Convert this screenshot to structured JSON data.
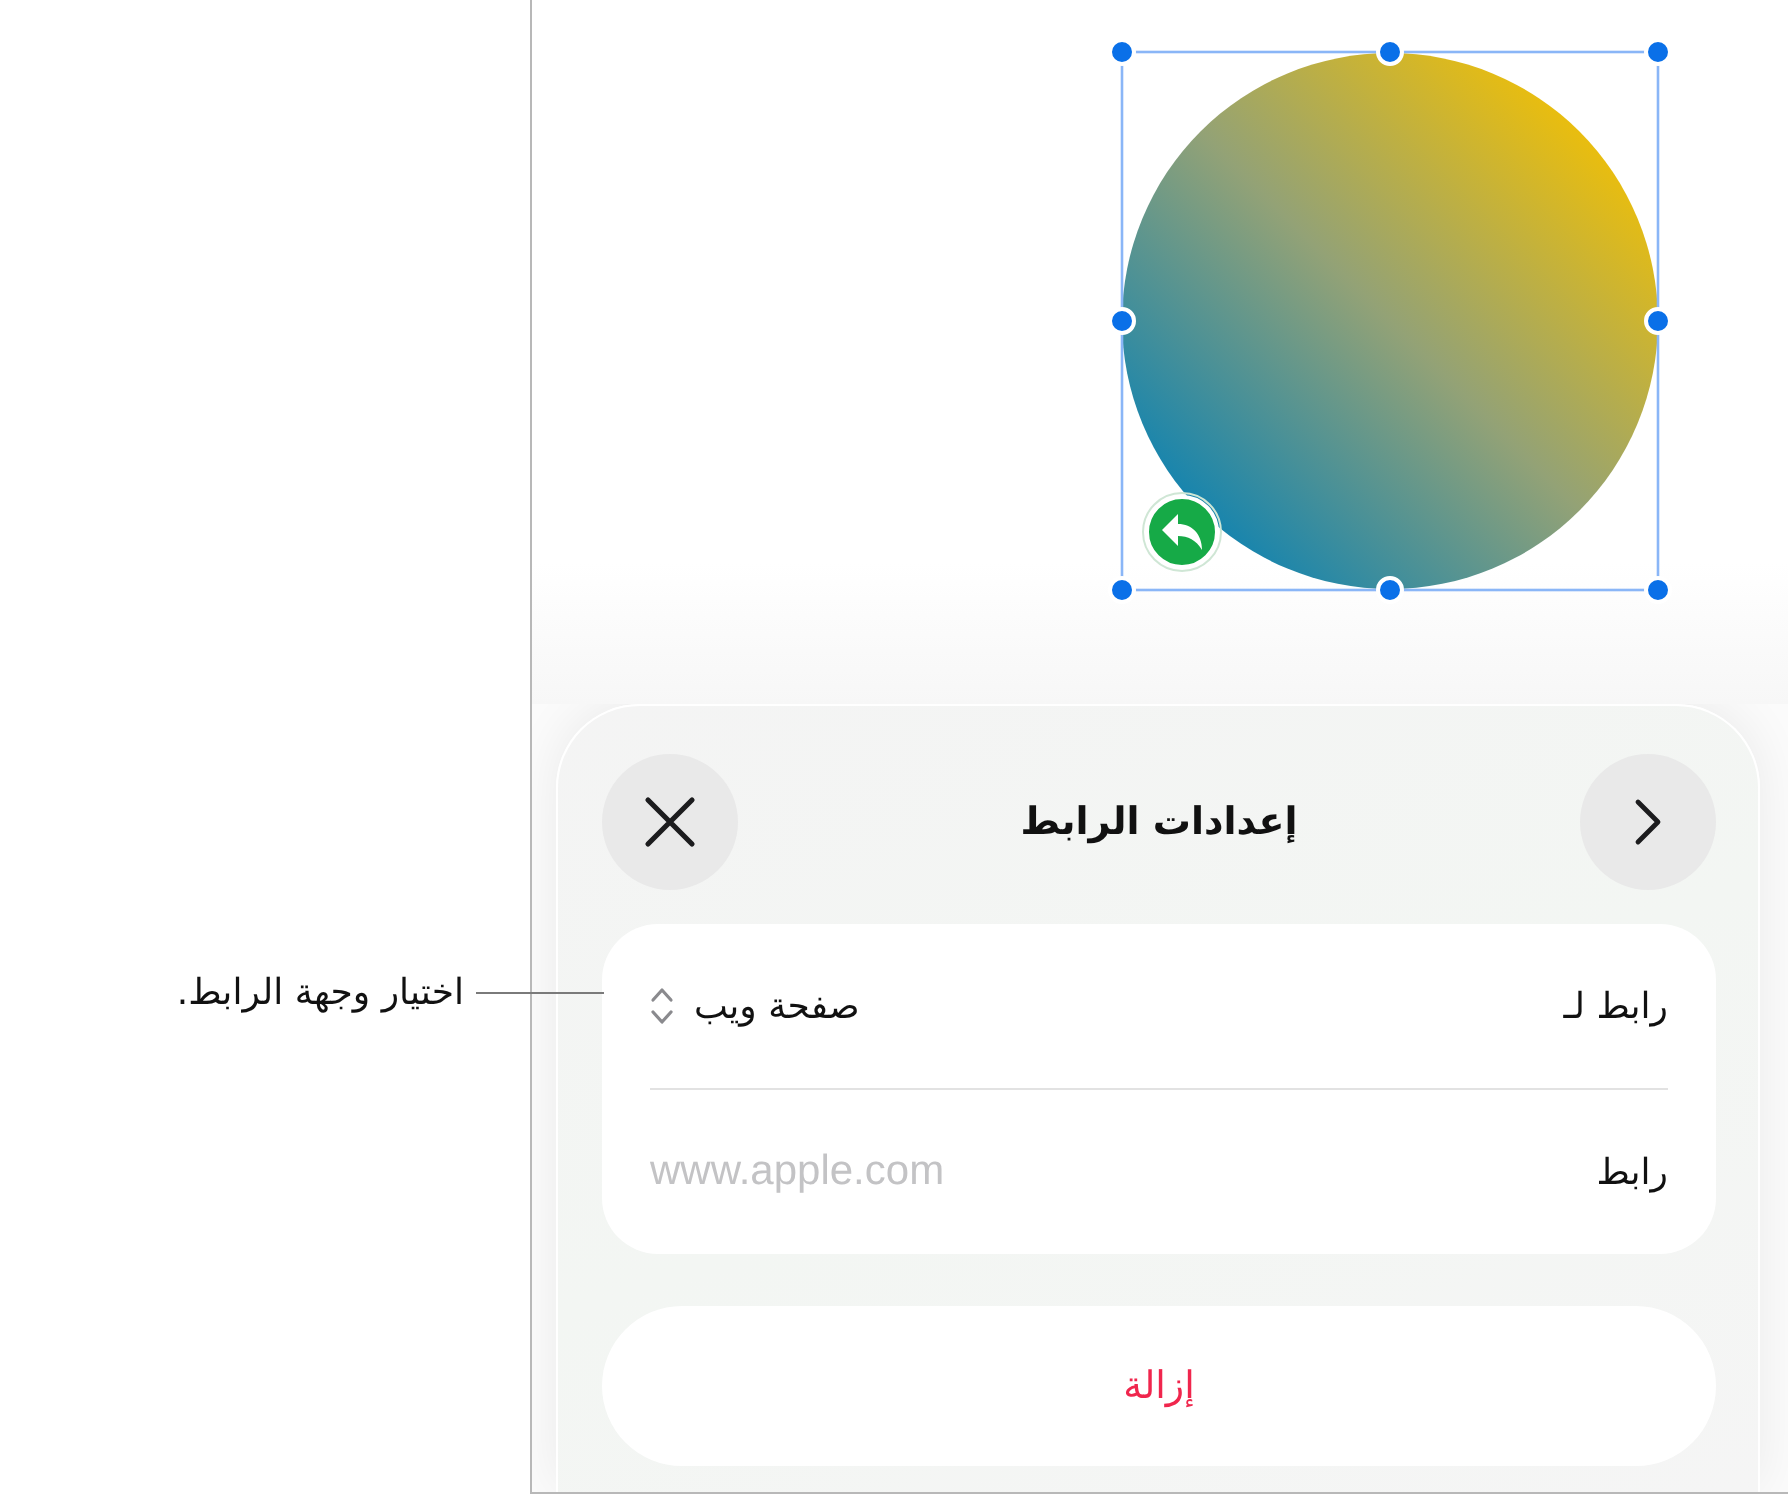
{
  "canvas": {
    "shape": {
      "selected": true,
      "linked": true
    }
  },
  "sheet": {
    "title": "إعدادات الرابط",
    "rows": [
      {
        "kind": "picker",
        "label": "رابط لـ",
        "value": "صفحة ويب"
      },
      {
        "kind": "field",
        "label": "رابط",
        "placeholder": "www.apple.com"
      }
    ],
    "remove_button": "إزالة"
  },
  "callout": {
    "text": "اختيار وجهة الرابط."
  }
}
